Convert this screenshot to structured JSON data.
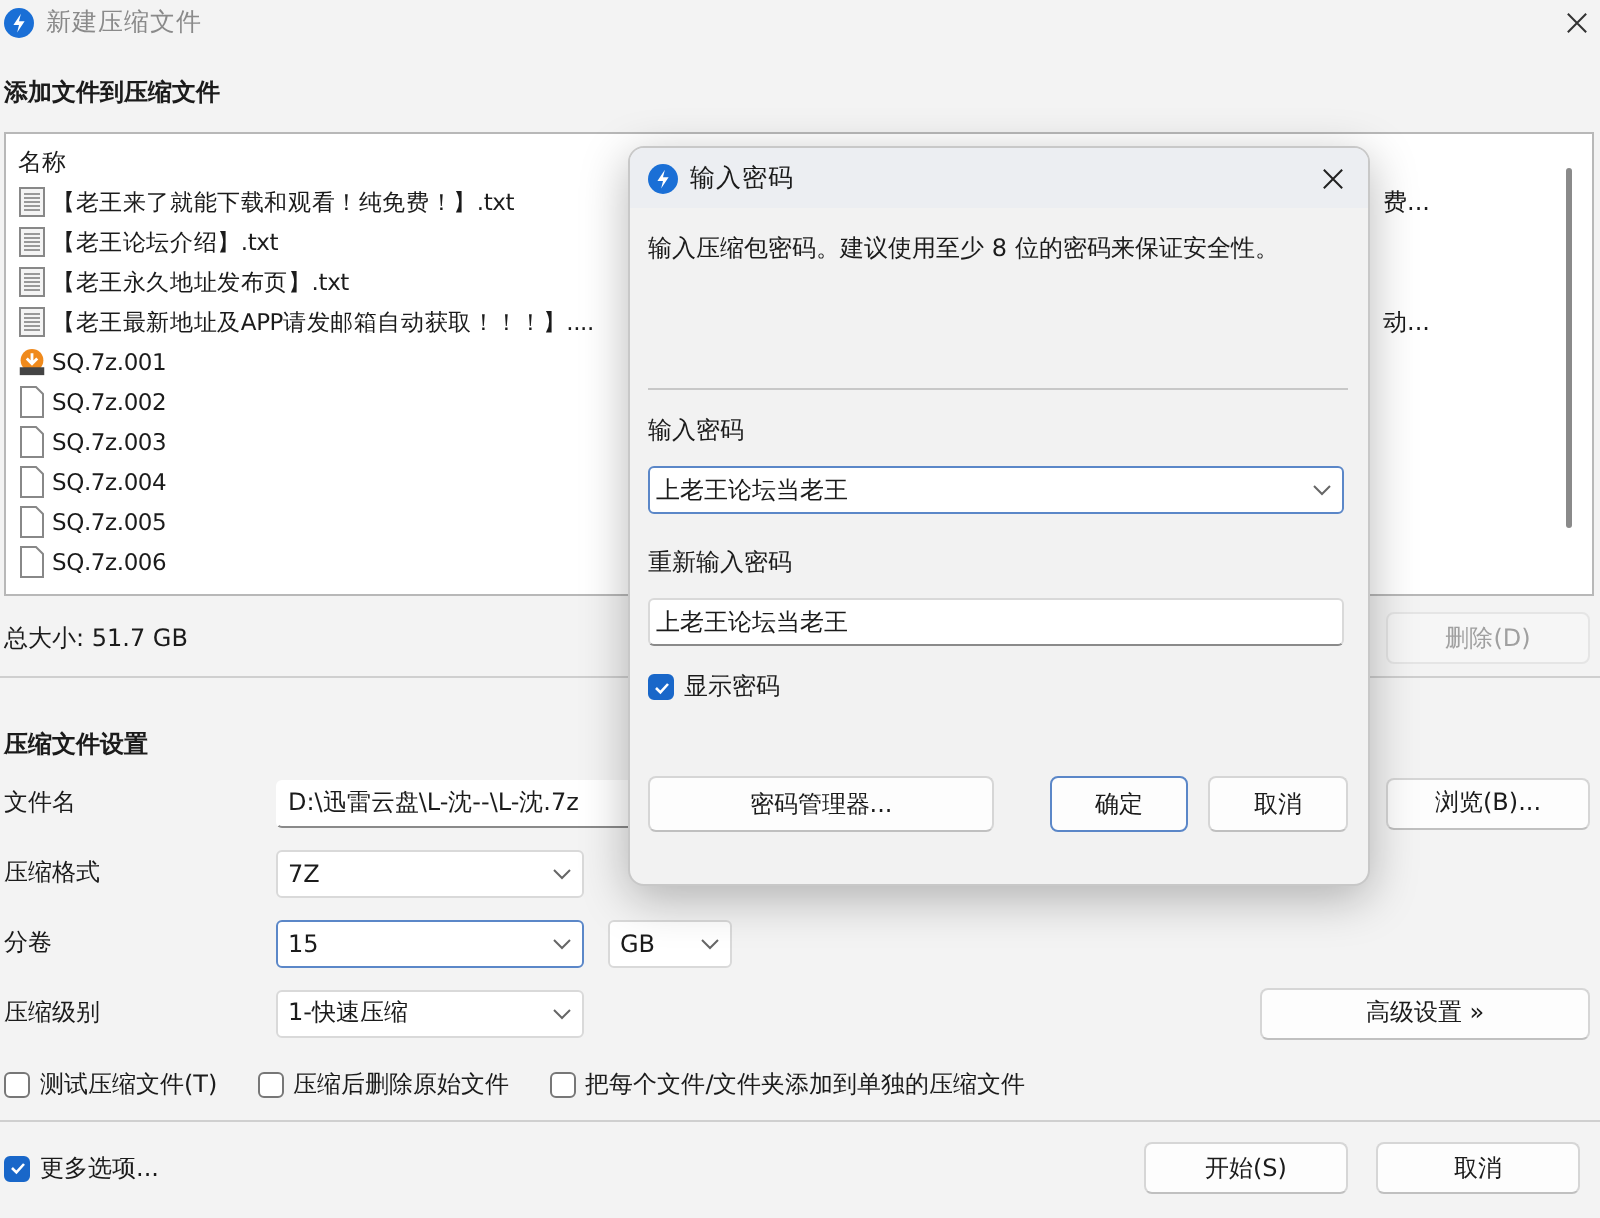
{
  "window": {
    "title": "新建压缩文件"
  },
  "add_section": {
    "heading": "添加文件到压缩文件"
  },
  "file_list": {
    "column_1": "名称",
    "rows": [
      {
        "kind": "text",
        "name": "【老王来了就能下载和观看！纯免费！】.txt",
        "column_2": "费..."
      },
      {
        "kind": "text",
        "name": "【老王论坛介绍】.txt"
      },
      {
        "kind": "text",
        "name": "【老王永久地址发布页】.txt"
      },
      {
        "kind": "text",
        "name": "【老王最新地址及APP请发邮箱自动获取！！！】....",
        "column_2": "动..."
      },
      {
        "kind": "archive",
        "name": "SQ.7z.001"
      },
      {
        "kind": "blank",
        "name": "SQ.7z.002"
      },
      {
        "kind": "blank",
        "name": "SQ.7z.003"
      },
      {
        "kind": "blank",
        "name": "SQ.7z.004"
      },
      {
        "kind": "blank",
        "name": "SQ.7z.005"
      },
      {
        "kind": "blank",
        "name": "SQ.7z.006"
      }
    ]
  },
  "total_size": "总大小: 51.7 GB",
  "delete_button": {
    "label": "删除(D)",
    "disabled": true
  },
  "settings": {
    "heading": "压缩文件设置",
    "file_name": {
      "label": "文件名",
      "value": "D:\\迅雷云盘\\L-沈--\\L-沈.7z",
      "browse": "浏览(B)..."
    },
    "format": {
      "label": "压缩格式",
      "value": "7Z"
    },
    "split": {
      "label": "分卷",
      "value": "15",
      "unit": "GB"
    },
    "level": {
      "label": "压缩级别",
      "value": "1-快速压缩",
      "advanced": "高级设置 »"
    },
    "options": [
      {
        "label": "测试压缩文件(T)",
        "checked": false
      },
      {
        "label": "压缩后删除原始文件",
        "checked": false
      },
      {
        "label": "把每个文件/文件夹添加到单独的压缩文件",
        "checked": false
      }
    ]
  },
  "more_options": {
    "label": "更多选项...",
    "checked": true
  },
  "buttons": {
    "start": "开始(S)",
    "cancel": "取消"
  },
  "password_dialog": {
    "title": "输入密码",
    "hint": "输入压缩包密码。建议使用至少 8 位的密码来保证安全性。",
    "password_label": "输入密码",
    "password_value": "上老王论坛当老王",
    "confirm_label": "重新输入密码",
    "confirm_value": "上老王论坛当老王",
    "show_password": {
      "label": "显示密码",
      "checked": true
    },
    "manager_button": "密码管理器...",
    "ok_button": "确定",
    "cancel_button": "取消"
  }
}
